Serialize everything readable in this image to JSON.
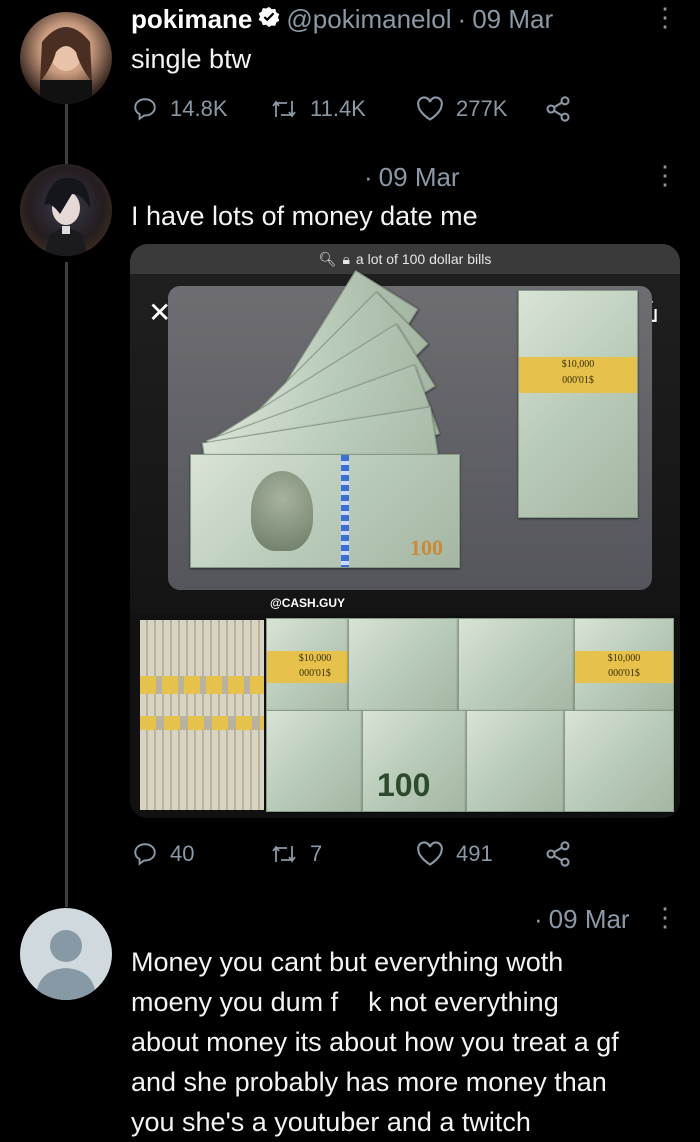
{
  "tweet1": {
    "display_name": "pokimane",
    "handle": "@pokimanelol",
    "sep": "·",
    "date": "09 Mar",
    "text": "single btw",
    "replies": "14.8K",
    "retweets": "11.4K",
    "likes": "277K"
  },
  "tweet2": {
    "sep": "·",
    "date": "09 Mar",
    "text": "I have lots of money date me",
    "media": {
      "search_query": "a lot of 100 dollar bills",
      "watermark": "@CASH.GUY",
      "band_value_1": "$10,000",
      "band_value_2": "000'01$",
      "bill_denomination": "100"
    },
    "replies": "40",
    "retweets": "7",
    "likes": "491"
  },
  "tweet3": {
    "sep": "·",
    "date": "09 Mar",
    "lines": [
      "Money you cant but everything woth",
      "moeny you dum f    k not everything",
      "about money its about how you treat a gf",
      "and she probably has more money than",
      "you she's a youtuber and a twitch"
    ]
  },
  "colors": {
    "background": "#000000",
    "muted": "#8b98a5",
    "verified_badge": "#ffffff"
  }
}
